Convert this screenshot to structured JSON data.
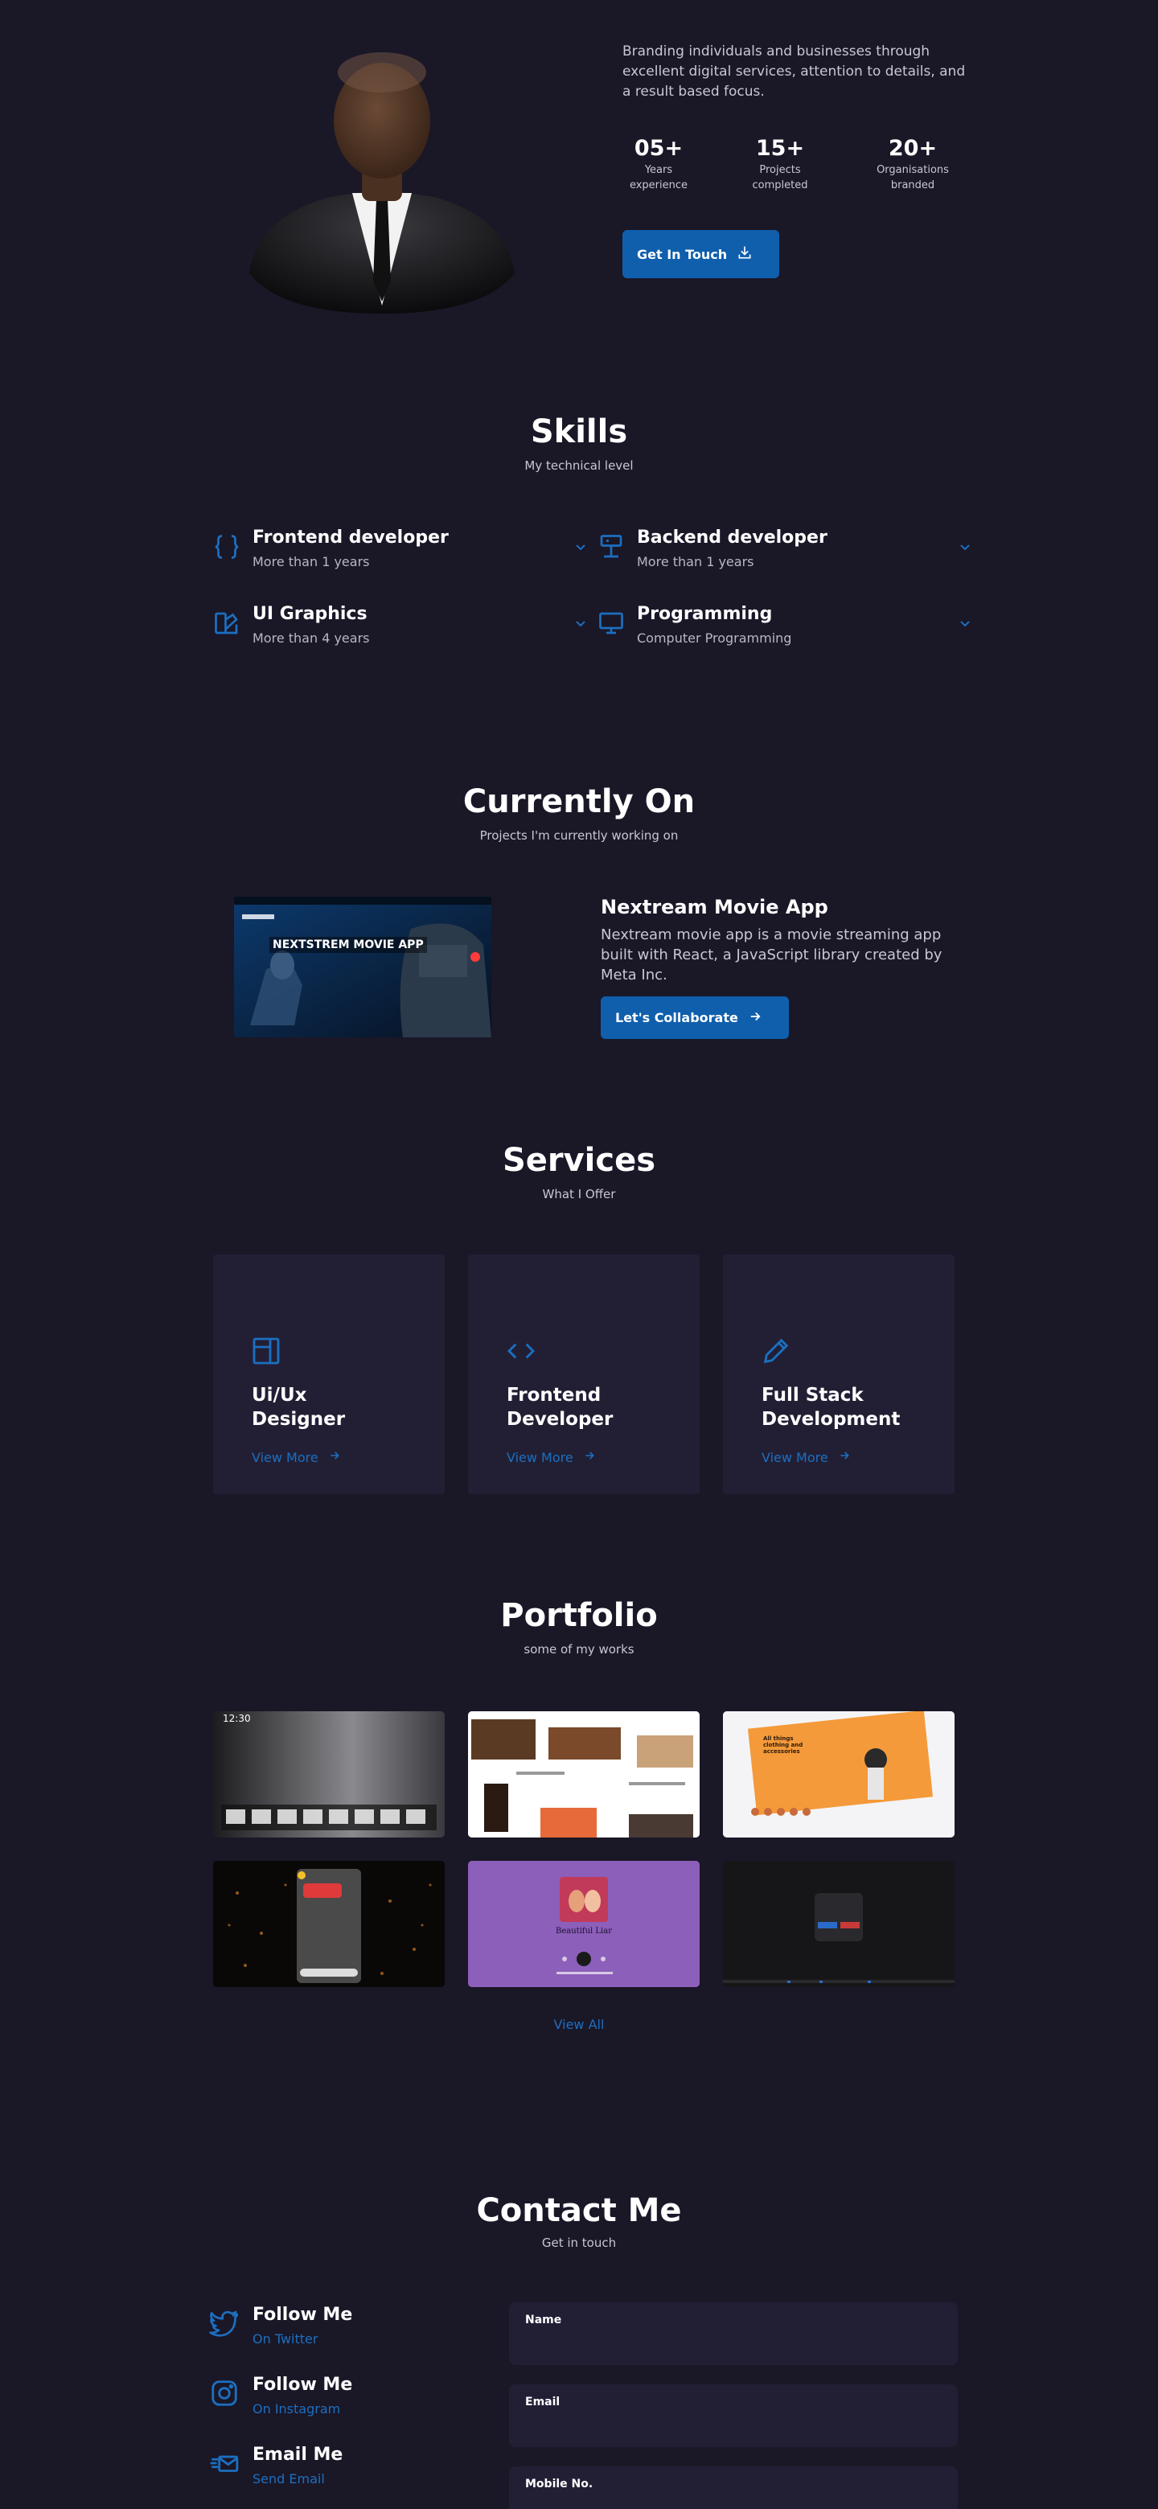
{
  "colors": {
    "background": "#1a1727",
    "card": "#221f35",
    "accent": "#1c6fc0",
    "button": "#0f5fad"
  },
  "hero": {
    "description": "Branding individuals and businesses through excellent digital services, attention to details, and a result based focus.",
    "stats": [
      {
        "number": "05+",
        "label_line1": "Years",
        "label_line2": "experience"
      },
      {
        "number": "15+",
        "label_line1": "Projects",
        "label_line2": "completed"
      },
      {
        "number": "20+",
        "label_line1": "Organisations",
        "label_line2": "branded"
      }
    ],
    "cta_label": "Get In Touch",
    "cta_icon": "download-icon"
  },
  "skills": {
    "title": "Skills",
    "subtitle": "My technical level",
    "items": [
      {
        "name": "Frontend developer",
        "desc": "More than 1 years",
        "icon": "braces-icon"
      },
      {
        "name": "Backend developer",
        "desc": "More than 1 years",
        "icon": "server-icon"
      },
      {
        "name": "UI Graphics",
        "desc": "More than 4 years",
        "icon": "swatchbook-icon"
      },
      {
        "name": "Programming",
        "desc": "Computer Programming",
        "icon": "monitor-icon"
      }
    ]
  },
  "current": {
    "title": "Currently On",
    "subtitle": "Projects I'm currently working on",
    "image_caption": "NEXTSTREM MOVIE APP",
    "project_title": "Nextream Movie App",
    "project_desc": "Nextream movie app is a movie streaming app built with React, a JavaScript library created by Meta Inc.",
    "cta_label": "Let's Collaborate"
  },
  "services": {
    "title": "Services",
    "subtitle": "What I Offer",
    "items": [
      {
        "line1": "Ui/Ux",
        "line2": "Designer",
        "icon": "layout-icon",
        "more": "View More"
      },
      {
        "line1": "Frontend",
        "line2": "Developer",
        "icon": "code-icon",
        "more": "View More"
      },
      {
        "line1": "Full Stack",
        "line2": "Development",
        "icon": "pencil-icon",
        "more": "View More"
      }
    ]
  },
  "portfolio": {
    "title": "Portfolio",
    "subtitle": "some of my works",
    "view_all": "View All",
    "thumb_time": "12:30",
    "thumb_store": "All things clothing and accessories",
    "thumb_artist": "Beautiful Liar"
  },
  "contact": {
    "title": "Contact Me",
    "subtitle": "Get in touch",
    "items": [
      {
        "title": "Follow Me",
        "sub": "On Twitter",
        "icon": "twitter-icon"
      },
      {
        "title": "Follow Me",
        "sub": "On Instagram",
        "icon": "instagram-icon"
      },
      {
        "title": "Email Me",
        "sub": "Send Email",
        "icon": "mail-icon"
      }
    ],
    "fields": [
      {
        "label": "Name",
        "value": ""
      },
      {
        "label": "Email",
        "value": ""
      },
      {
        "label": "Mobile No.",
        "value": ""
      }
    ]
  }
}
